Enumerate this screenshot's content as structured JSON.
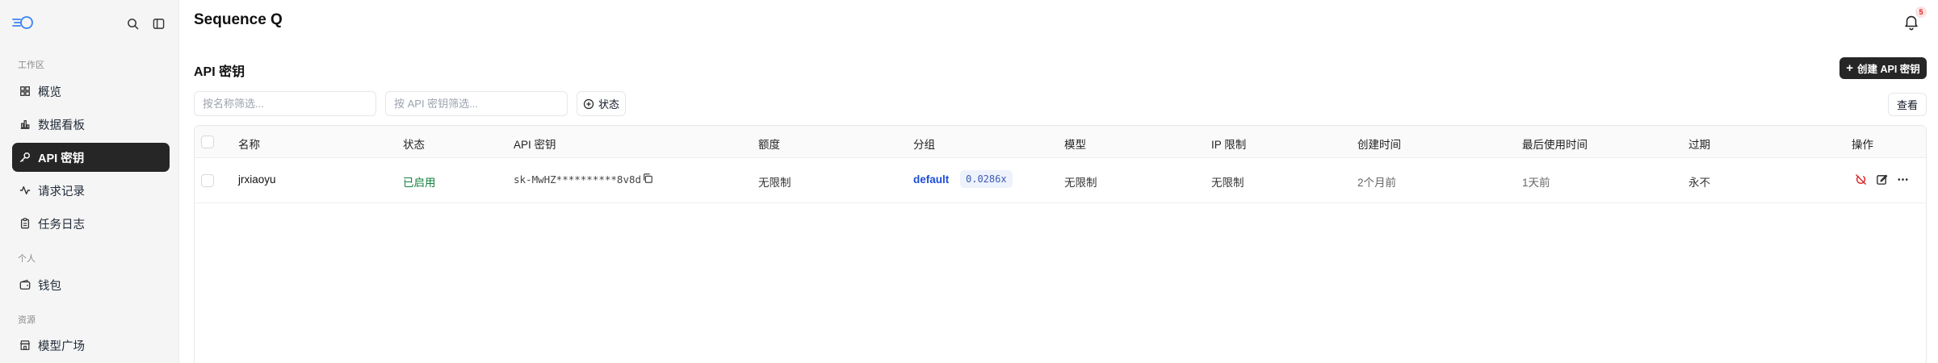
{
  "app": {
    "title": "Sequence Q",
    "notification_count": "5"
  },
  "sidebar": {
    "sections": [
      {
        "label": "工作区"
      },
      {
        "label": "个人"
      },
      {
        "label": "资源"
      }
    ],
    "items": [
      {
        "label": "概览",
        "icon": "grid-icon"
      },
      {
        "label": "数据看板",
        "icon": "bar-chart-icon"
      },
      {
        "label": "API 密钥",
        "icon": "key-icon",
        "active": true
      },
      {
        "label": "请求记录",
        "icon": "activity-icon"
      },
      {
        "label": "任务日志",
        "icon": "clipboard-icon"
      },
      {
        "label": "钱包",
        "icon": "wallet-icon"
      },
      {
        "label": "模型广场",
        "icon": "store-icon"
      }
    ]
  },
  "main": {
    "section_title": "API 密钥",
    "create_button": "创建 API 密钥",
    "filters": {
      "name_placeholder": "按名称筛选...",
      "key_placeholder": "按 API 密钥筛选...",
      "status_label": "状态",
      "view_label": "查看"
    },
    "table": {
      "columns": [
        "名称",
        "状态",
        "API 密钥",
        "额度",
        "分组",
        "模型",
        "IP 限制",
        "创建时间",
        "最后使用时间",
        "过期",
        "操作"
      ],
      "rows": [
        {
          "name": "jrxiaoyu",
          "status": "已启用",
          "api_key": "sk-MwHZ**********8v8d",
          "quota": "无限制",
          "group": "default",
          "ratio": "0.0286x",
          "models": "无限制",
          "ip_limit": "无限制",
          "created": "2个月前",
          "last_used": "1天前",
          "expires": "永不"
        }
      ]
    }
  },
  "colors": {
    "active_bg": "#262626",
    "status_ok": "#15803d",
    "group_link": "#1d4ed8",
    "badge_red": "#dc2626"
  }
}
